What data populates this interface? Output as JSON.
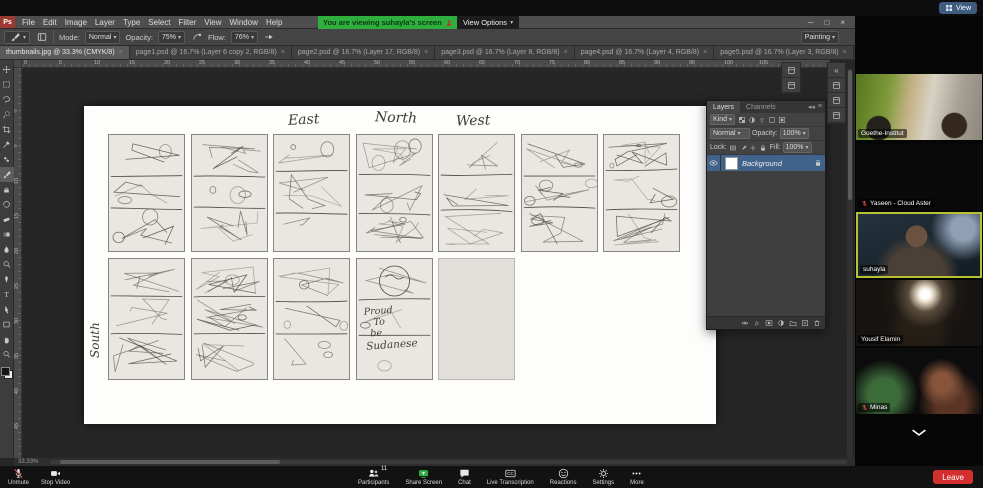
{
  "colors": {
    "share_green": "#2eae44",
    "leave_red": "#d32f2f",
    "banner_green": "#2fae3e",
    "active_tile_border": "#b6c232",
    "selected_layer_blue": "#41628b"
  },
  "zoom": {
    "topbar": {
      "view_button": "View",
      "view_icon": "grid-icon"
    },
    "banner": {
      "text": "You are viewing suhayla's screen",
      "icon": "shared-screen-person-icon",
      "view_options": "View Options"
    },
    "sidebar": {
      "participants": [
        {
          "name": "Goethe-Institut",
          "muted": false,
          "active": false,
          "scene": "classroom"
        },
        {
          "name": "Yaseen - Cloud Aster",
          "muted": true,
          "active": false,
          "scene": "dark"
        },
        {
          "name": "suhayla",
          "muted": false,
          "active": true,
          "scene": "speaker"
        },
        {
          "name": "Yousif Elamin",
          "muted": false,
          "active": false,
          "scene": "backlit"
        },
        {
          "name": "Minas",
          "muted": true,
          "active": false,
          "scene": "dim"
        }
      ],
      "more_indicator": "chevron-down-icon"
    },
    "controls": {
      "left": [
        {
          "label": "Unmute",
          "icon": "mic-muted"
        },
        {
          "label": "Stop Video",
          "icon": "camera"
        }
      ],
      "center": [
        {
          "label": "Participants",
          "icon": "participants",
          "badge": "11"
        },
        {
          "label": "Share Screen",
          "icon": "share-screen"
        },
        {
          "label": "Chat",
          "icon": "chat"
        },
        {
          "label": "Live Transcription",
          "icon": "cc"
        },
        {
          "label": "Reactions",
          "icon": "reactions"
        },
        {
          "label": "Settings",
          "icon": "settings"
        },
        {
          "label": "More",
          "icon": "more"
        }
      ],
      "leave_label": "Leave"
    }
  },
  "photoshop": {
    "logo": "Ps",
    "menus": [
      "File",
      "Edit",
      "Image",
      "Layer",
      "Type",
      "Select",
      "Filter",
      "View",
      "Window",
      "Help"
    ],
    "window_controls": [
      "minimize",
      "maximize",
      "close"
    ],
    "options_bar": {
      "tool_icon": "brush-preset-icon",
      "mode_label": "Mode:",
      "mode_value": "Normal",
      "opacity_label": "Opacity:",
      "opacity_value": "75%",
      "flow_label": "Flow:",
      "flow_value": "76%",
      "workspace_value": "Painting"
    },
    "document_tabs": [
      {
        "title": "thumbnails.jpg @ 33.3% (CMYK/8)",
        "active": true
      },
      {
        "title": "page1.psd @ 16.7% (Layer 6 copy 2, RGB/8)",
        "active": false
      },
      {
        "title": "page2.psd @ 16.7% (Layer 17, RGB/8)",
        "active": false
      },
      {
        "title": "page3.psd @ 16.7% (Layer 8, RGB/8)",
        "active": false
      },
      {
        "title": "page4.psd @ 16.7% (Layer 4, RGB/8)",
        "active": false
      },
      {
        "title": "page5.psd @ 16.7% (Layer 3, RGB/8)",
        "active": false
      }
    ],
    "ruler": {
      "h_labels": [
        "0",
        "5",
        "10",
        "15",
        "20",
        "25",
        "30",
        "35",
        "40",
        "45",
        "50",
        "55",
        "60",
        "65",
        "70",
        "75",
        "80",
        "85",
        "90",
        "95",
        "100",
        "105"
      ],
      "v_labels": [
        "0",
        "5",
        "10",
        "15",
        "20",
        "25",
        "30",
        "35",
        "40",
        "45"
      ]
    },
    "tools": [
      "move",
      "rect-marquee",
      "lasso",
      "quick-select",
      "crop",
      "eyedropper",
      "spot-heal",
      "brush",
      "clone-stamp",
      "history-brush",
      "eraser",
      "gradient",
      "blur",
      "dodge",
      "pen",
      "type",
      "path-select",
      "shape",
      "hand",
      "zoom"
    ],
    "layers_panel": {
      "tabs": [
        {
          "label": "Layers",
          "active": true
        },
        {
          "label": "Channels",
          "active": false
        }
      ],
      "kind_label": "Kind",
      "filter_icons": [
        "pixel-layer-filter",
        "adjustment-layer-filter",
        "type-layer-filter",
        "shape-layer-filter",
        "smart-object-filter"
      ],
      "blend_mode": "Normal",
      "opacity_label": "Opacity:",
      "opacity_value": "100%",
      "lock_label": "Lock:",
      "lock_icons": [
        "lock-transparency",
        "lock-image",
        "lock-position",
        "lock-all"
      ],
      "fill_label": "Fill:",
      "fill_value": "100%",
      "layers": [
        {
          "name": "Background",
          "visible": true,
          "locked": true,
          "selected": true
        }
      ],
      "bottom_icons": [
        "link-layers",
        "layer-effects",
        "add-layer-mask",
        "new-adjustment-layer",
        "new-group",
        "new-layer",
        "delete-layer"
      ]
    },
    "right_dock_icons": [
      "collapse-dock",
      "color-panel",
      "swatches-panel",
      "brush-panel"
    ],
    "mini_dock_icons": [
      "brush-presets-panel",
      "tool-presets-panel"
    ],
    "status": {
      "zoom_value": "33.33%"
    },
    "canvas": {
      "direction_labels": [
        {
          "text": "East"
        },
        {
          "text": "North"
        },
        {
          "text": "West"
        }
      ],
      "south_label": "South",
      "caption_lines": [
        "Proud",
        "To",
        "be",
        "Sudanese"
      ]
    }
  }
}
